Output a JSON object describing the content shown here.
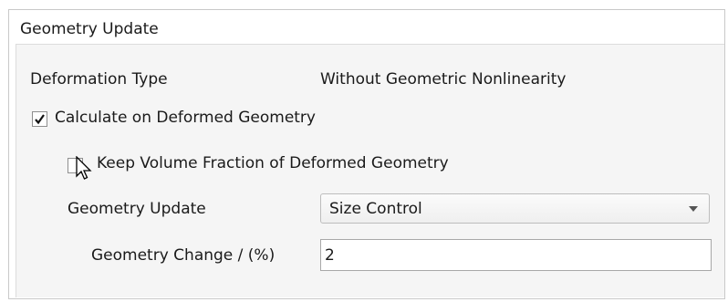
{
  "panel": {
    "title": "Geometry Update"
  },
  "deformation": {
    "label": "Deformation Type",
    "value": "Without Geometric Nonlinearity"
  },
  "calculate_deformed": {
    "label": "Calculate on Deformed Geometry",
    "checked": true
  },
  "keep_volume_fraction": {
    "label": "Keep Volume Fraction of Deformed Geometry",
    "checked": false
  },
  "geometry_update": {
    "label": "Geometry Update",
    "selected": "Size Control",
    "icon": "chevron-down-icon"
  },
  "geometry_change": {
    "label": "Geometry Change / (%)",
    "value": "2"
  },
  "cursor": {
    "icon": "mouse-pointer-icon"
  }
}
